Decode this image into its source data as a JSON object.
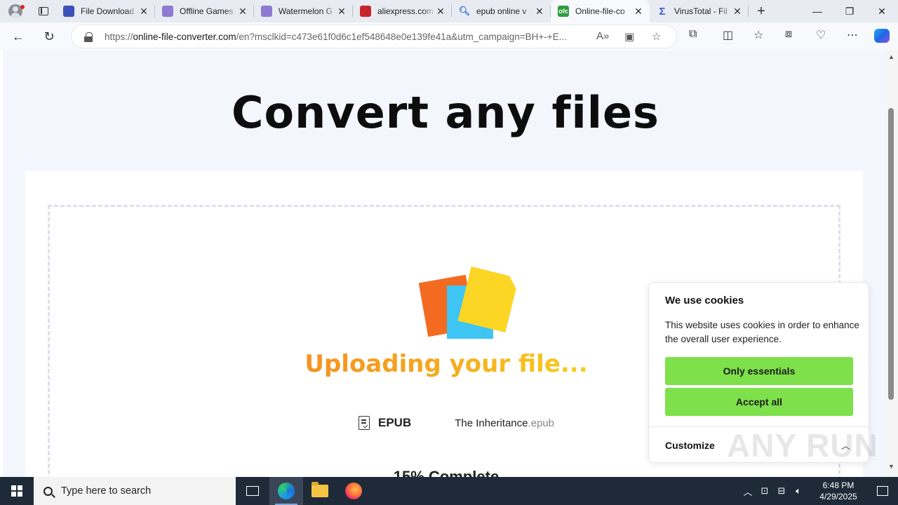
{
  "browser": {
    "tabs": [
      {
        "title": "File Download",
        "favicon_color": "#3d4fb8",
        "active": false
      },
      {
        "title": "Offline Games",
        "favicon_color": "#8e7ad3",
        "active": false
      },
      {
        "title": "Watermelon G",
        "favicon_color": "#8e7ad3",
        "active": false
      },
      {
        "title": "aliexpress.com",
        "favicon_color": "#c8242b",
        "active": false
      },
      {
        "title": "epub online v",
        "favicon_color": "#3a6fd8",
        "active": false
      },
      {
        "title": "Online-file-co",
        "favicon_color": "#2e9e3d",
        "favicon_text": "ofc",
        "active": true
      },
      {
        "title": "VirusTotal - Fil",
        "favicon_color": "#3b5bdb",
        "active": false
      }
    ],
    "new_tab_label": "+",
    "window_controls": {
      "minimize": "—",
      "restore": "❐",
      "close": "✕"
    },
    "url_host": "online-file-converter.com",
    "url_prefix": "https://",
    "url_rest": "/en?msclkid=c473e61f0d6c1ef548648e0e139fe41a&utm_campaign=BH+-+E..."
  },
  "page": {
    "headline": "Convert any files",
    "status_text": "Uploading your file...",
    "file_format": "EPUB",
    "file_name": "The Inheritance",
    "file_ext": ".epub",
    "progress_percent": 15,
    "progress_label": "15% Complete"
  },
  "cookie_dialog": {
    "title": "We use cookies",
    "body": "This website uses cookies in order to enhance the overall user experience.",
    "only_essentials_label": "Only essentials",
    "accept_all_label": "Accept all",
    "customize_label": "Customize",
    "button_color": "#7ee04b"
  },
  "watermark": "ANY RUN",
  "taskbar": {
    "search_placeholder": "Type here to search",
    "time": "6:48 PM",
    "date": "4/29/2025"
  }
}
